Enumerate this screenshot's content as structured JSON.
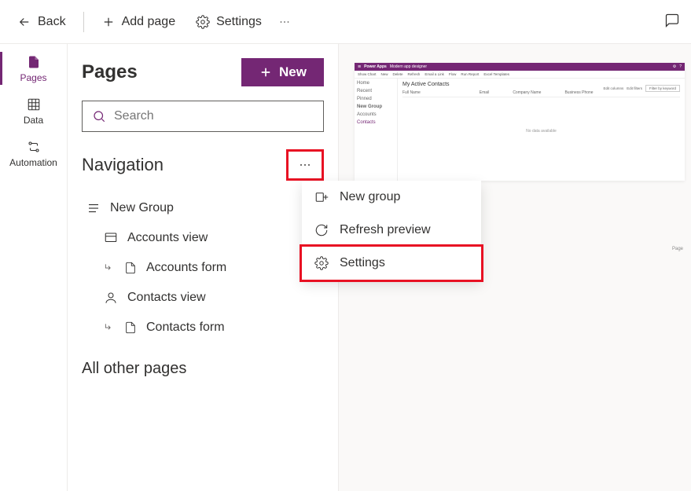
{
  "topbar": {
    "back": "Back",
    "add_page": "Add page",
    "settings": "Settings"
  },
  "rail": {
    "pages": "Pages",
    "data": "Data",
    "automation": "Automation"
  },
  "pages_panel": {
    "title": "Pages",
    "new_btn": "New",
    "search_placeholder": "Search",
    "navigation_title": "Navigation",
    "group_label": "New Group",
    "items": [
      {
        "label": "Accounts view"
      },
      {
        "label": "Accounts form"
      },
      {
        "label": "Contacts view"
      },
      {
        "label": "Contacts form"
      }
    ],
    "other_pages_title": "All other pages"
  },
  "context_menu": {
    "new_group": "New group",
    "refresh_preview": "Refresh preview",
    "settings": "Settings"
  },
  "preview": {
    "brand": "Power Apps",
    "app_name": "Modern app designer",
    "toolbar": {
      "show_chart": "Show Chart",
      "new": "New",
      "delete": "Delete",
      "refresh": "Refresh",
      "email_link": "Email a Link",
      "flow": "Flow",
      "run_report": "Run Report",
      "excel_templates": "Excel Templates"
    },
    "side": {
      "home": "Home",
      "recent": "Recent",
      "pinned": "Pinned",
      "group": "New Group",
      "accounts": "Accounts",
      "contacts": "Contacts"
    },
    "main_title": "My Active Contacts",
    "edit_columns": "Edit columns",
    "edit_filters": "Edit filters",
    "filter_placeholder": "Filter by keyword",
    "cols": {
      "full_name": "Full Name",
      "email": "Email",
      "company_name": "Company Name",
      "business_phone": "Business Phone"
    },
    "empty": "No data available",
    "page": "Page"
  }
}
